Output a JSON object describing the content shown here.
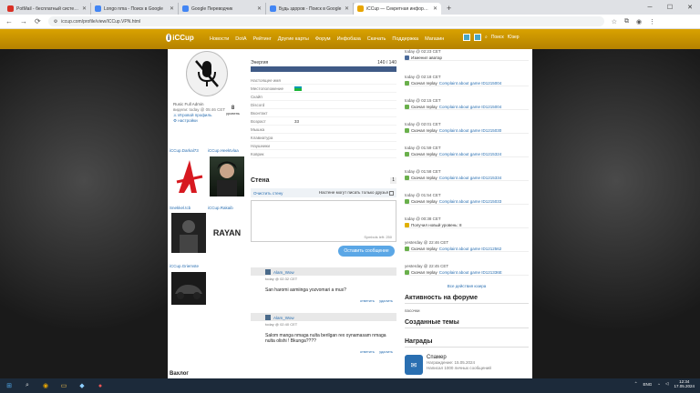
{
  "browser": {
    "tabs": [
      {
        "label": "PotMail - бесплатный системный...",
        "color": "#d93025"
      },
      {
        "label": "Longo nma - Поиск в Google",
        "color": "#4285f4"
      },
      {
        "label": "Google Переводчик",
        "color": "#4285f4"
      },
      {
        "label": "Будь здоров - Поиск в Google",
        "color": "#4285f4"
      },
      {
        "label": "iCCup — Секретная информация",
        "color": "#e8a500",
        "active": true
      }
    ],
    "new_tab": "+",
    "url": "iccup.com/profile/view/ICCup.VPN.html"
  },
  "site": {
    "logo": "iCCup",
    "menu": [
      "Новости",
      "DotA",
      "Рейтинг",
      "Другие карты",
      "Форум",
      "Инфобаза",
      "Скачать",
      "Поддержка",
      "Магазин"
    ],
    "search": "Поиск",
    "user": "Юзер"
  },
  "profile": {
    "name": "Rusic Full Admin",
    "seen": "видели: today @ 05:46 CET",
    "action1": "Игровой профиль",
    "action2": "настройки",
    "level_num": "8",
    "level_label": "уровень"
  },
  "friends": [
    {
      "name": "iCCup.Darkal73"
    },
    {
      "name": "iCCup.Heektvlaa"
    },
    {
      "name": "Snekkel.tcb"
    },
    {
      "name": "iCCup.Rakaib"
    },
    {
      "name": "iCCup.Griemste"
    }
  ],
  "friend_card_text": "RAYAN",
  "energy": {
    "label": "Энергия",
    "value": "140 / 140",
    "fraction": 1.0
  },
  "stats": [
    {
      "k": "Настоящее имя",
      "v": ""
    },
    {
      "k": "Местоположение",
      "v": ""
    },
    {
      "k": "Скайп",
      "v": ""
    },
    {
      "k": "Discord",
      "v": ""
    },
    {
      "k": "Вконтакт",
      "v": ""
    },
    {
      "k": "Возраст",
      "v": "33"
    },
    {
      "k": "Мышка",
      "v": ""
    },
    {
      "k": "Клавиатура",
      "v": ""
    },
    {
      "k": "Наушники",
      "v": ""
    },
    {
      "k": "Коврик",
      "v": ""
    }
  ],
  "wall": {
    "title": "Стена",
    "count": "1",
    "tab": "Очистить стену",
    "checkbox": "Настене могут писать только друзья",
    "symbols_left": "Symbols left: 250",
    "send": "Оставить сообщение"
  },
  "posts": [
    {
      "author": "Alam_Wow",
      "date": "today @ 02:32 CET",
      "text": "San haromi asmiinga yozvomari a mus?",
      "reply": "ответить",
      "delete": "удалить"
    },
    {
      "author": "Alam_Wow",
      "date": "today @ 02:40 CET",
      "text": "Salom manga nmaga nulta berilgan rex oynamasam nmaga nulta olishi ! Bkunga????",
      "reply": "ответить",
      "delete": "удалить"
    }
  ],
  "blog": "Вахлог",
  "events": [
    {
      "date": "today @ 02:23 CET",
      "text": "Изменил аватар",
      "link": ""
    },
    {
      "date": "today @ 02:18 CET",
      "text": "Скачал replay",
      "link": "Complaint about game ID1215004"
    },
    {
      "date": "today @ 02:15 CET",
      "text": "Скачал replay",
      "link": "Complaint about game ID1215004"
    },
    {
      "date": "today @ 02:01 CET",
      "text": "Скачал replay",
      "link": "Complaint about game ID1215030"
    },
    {
      "date": "today @ 01:59 CET",
      "text": "Скачал replay",
      "link": "Complaint about game ID1215324"
    },
    {
      "date": "today @ 01:58 CET",
      "text": "Скачал replay",
      "link": "Complaint about game ID1215334"
    },
    {
      "date": "today @ 01:54 CET",
      "text": "Скачал replay",
      "link": "Complaint about game ID1215033"
    },
    {
      "date": "today @ 00:38 CET",
      "text": "Получил новый уровень: 8",
      "link": ""
    },
    {
      "date": "yesterday @ 22:46 CET",
      "text": "Скачал replay",
      "link": "Complaint about game ID1212562"
    },
    {
      "date": "yesterday @ 22:45 CET",
      "text": "Скачал replay",
      "link": "Complaint about game ID121336E"
    }
  ],
  "all_actions": "Все действия юзера",
  "sections": {
    "forum": "Активность на форуме",
    "forum_sub": "пасочки",
    "topics": "Созданные темы",
    "awards": "Награды"
  },
  "award": {
    "title": "Спамер",
    "date": "Награждение: 15.05.2024",
    "desc": "Написал 1000 личных сообщений"
  },
  "taskbar": {
    "lang": "ENG",
    "time": "12:34",
    "date": "17.05.2024"
  }
}
